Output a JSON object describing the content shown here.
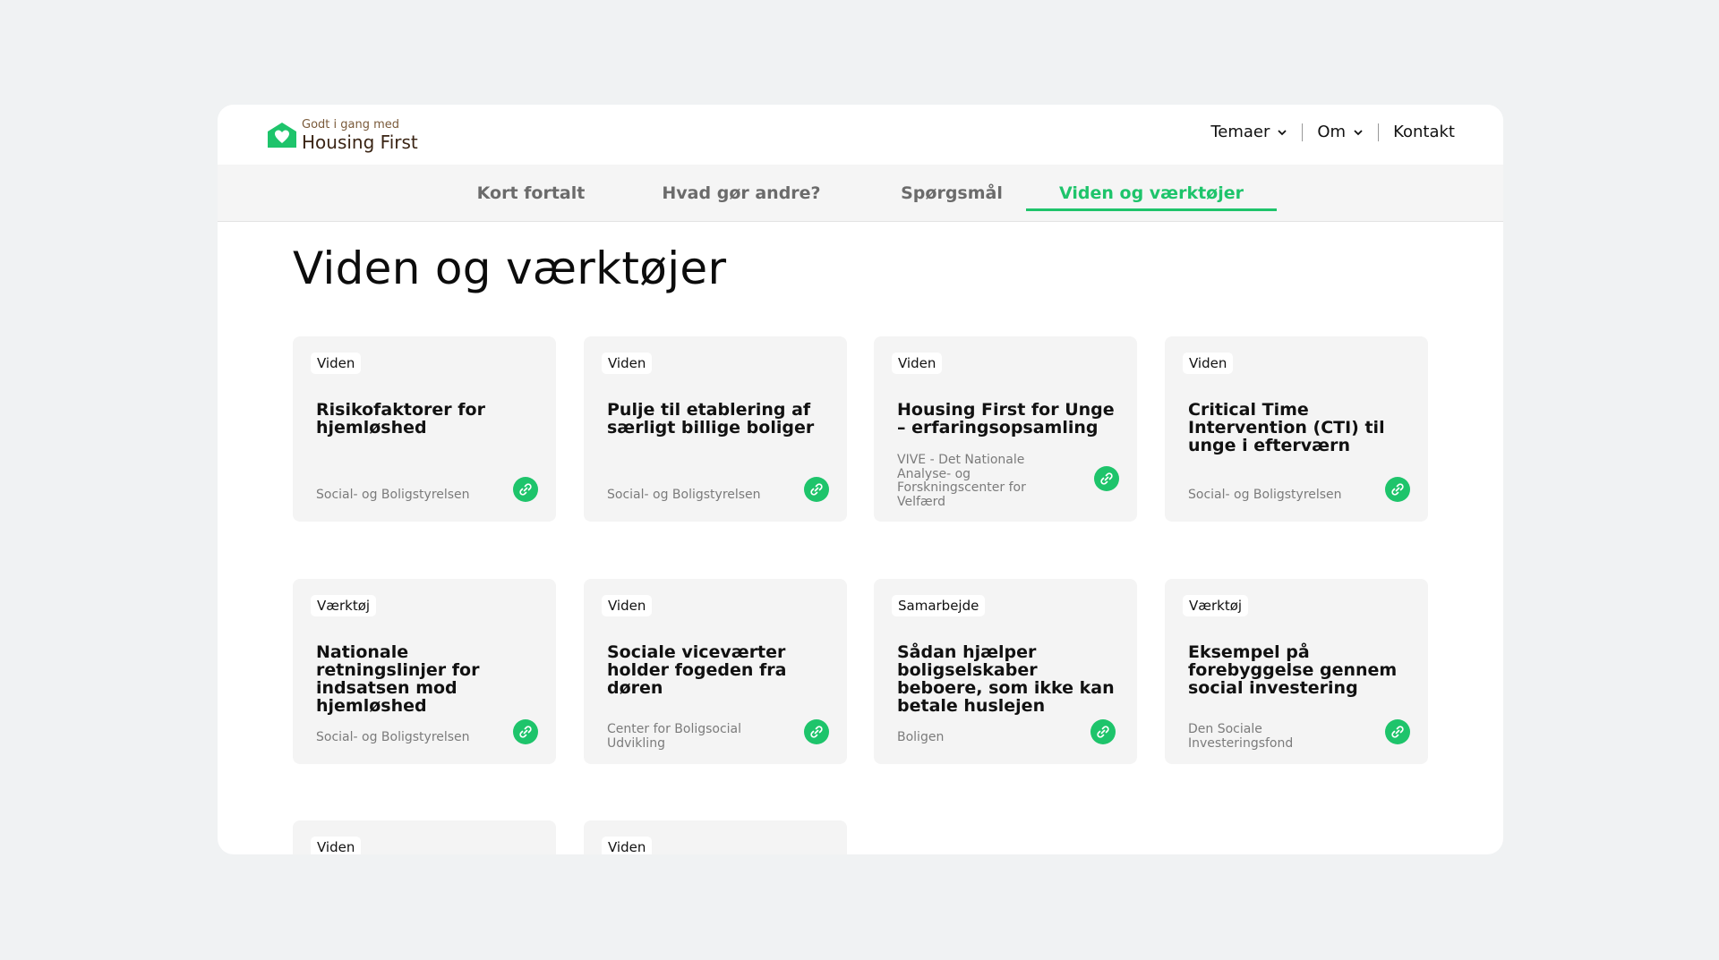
{
  "header": {
    "logo_small": "Godt i gang med",
    "logo_big": "Housing First",
    "nav": [
      {
        "label": "Temaer"
      },
      {
        "label": "Om"
      },
      {
        "label": "Kontakt"
      }
    ]
  },
  "subnav": {
    "tabs": [
      {
        "label": "Kort fortalt"
      },
      {
        "label": "Hvad gør andre?"
      },
      {
        "label": "Spørgsmål"
      },
      {
        "label": "Viden og værktøjer"
      }
    ],
    "active_tab": "Viden og værktøjer"
  },
  "page": {
    "title": "Viden og værktøjer"
  },
  "cards": [
    {
      "badge": "Viden",
      "title": "Risikofaktorer for hjemløshed",
      "source": "Social- og Boligstyrelsen"
    },
    {
      "badge": "Viden",
      "title": "Pulje til etablering af særligt billige boliger",
      "source": "Social- og Boligstyrelsen"
    },
    {
      "badge": "Viden",
      "title": "Housing First for Unge – erfaringsopsamling",
      "source": "VIVE - Det Nationale Analyse- og Forskningscenter for Velfærd"
    },
    {
      "badge": "Viden",
      "title": "Critical Time Intervention (CTI) til unge i efterværn",
      "source": "Social- og Boligstyrelsen"
    },
    {
      "badge": "Værktøj",
      "title": "Nationale retningslinjer for indsatsen mod hjemløshed",
      "source": "Social- og Boligstyrelsen"
    },
    {
      "badge": "Viden",
      "title": "Sociale viceværter holder fogeden fra døren",
      "source": "Center for Boligsocial Udvikling"
    },
    {
      "badge": "Samarbejde",
      "title": "Sådan hjælper boligselskaber beboere, som ikke kan betale huslejen",
      "source": "Boligen"
    },
    {
      "badge": "Værktøj",
      "title": "Eksempel på forebyggelse gennem social investering",
      "source": "Den Sociale Investeringsfond"
    },
    {
      "badge": "Viden",
      "title": "",
      "source": ""
    },
    {
      "badge": "Viden",
      "title": "",
      "source": ""
    }
  ],
  "colors": {
    "accent": "#1ec46b",
    "background": "#f0f2f3",
    "card": "#f4f4f4"
  }
}
